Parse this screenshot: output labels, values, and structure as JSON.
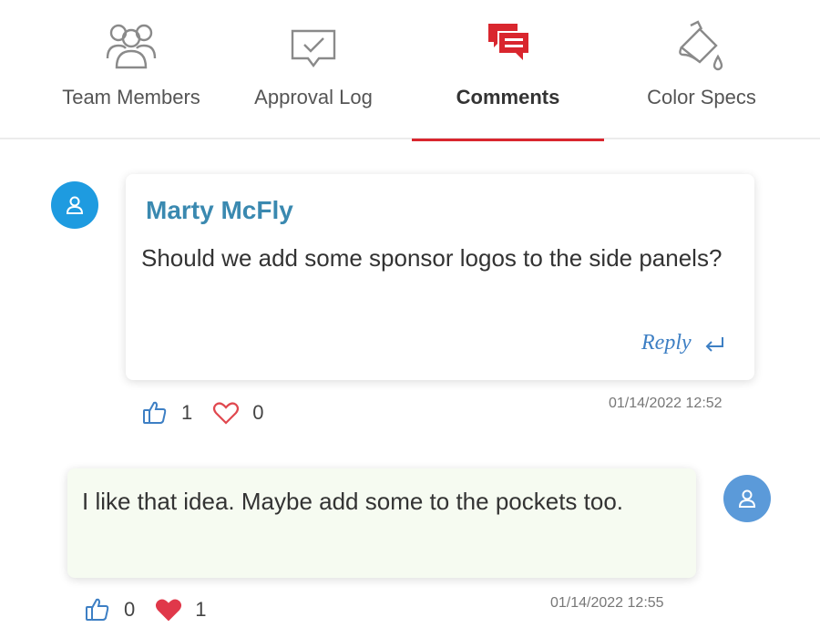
{
  "tabs": [
    {
      "label": "Team Members",
      "icon": "team-icon",
      "active": false
    },
    {
      "label": "Approval Log",
      "icon": "approval-check-icon",
      "active": false
    },
    {
      "label": "Comments",
      "icon": "comments-icon",
      "active": true
    },
    {
      "label": "Color Specs",
      "icon": "paint-bucket-icon",
      "active": false
    }
  ],
  "colors": {
    "accent": "#d9262e",
    "author": "#3a89b0",
    "link": "#3d7fc4",
    "avatar_1": "#1e9be0",
    "avatar_2": "#5b9ad9",
    "reply_card_bg": "#f6fbf1"
  },
  "comments": [
    {
      "author": "Marty McFly",
      "text": "Should we add some sponsor logos to the side panels?",
      "reply_label": "Reply",
      "likes": "1",
      "hearts": "0",
      "heart_filled": false,
      "timestamp": "01/14/2022 12:52"
    },
    {
      "text": "I like that idea. Maybe add some to the pockets too.",
      "likes": "0",
      "hearts": "1",
      "heart_filled": true,
      "timestamp": "01/14/2022 12:55"
    }
  ]
}
